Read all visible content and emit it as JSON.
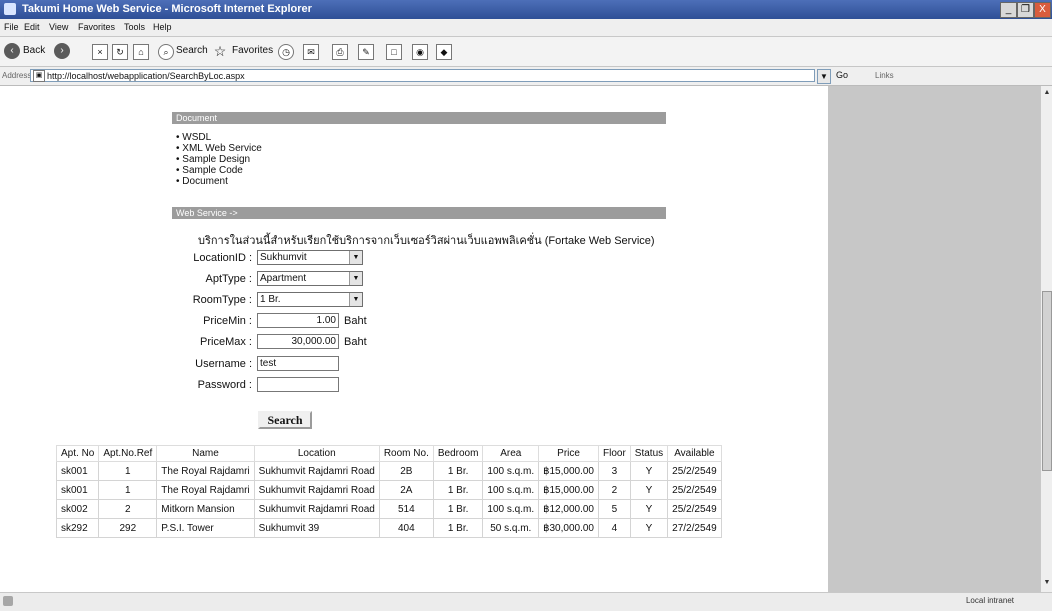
{
  "window": {
    "title": "Takumi Home Web Service - Microsoft Internet Explorer",
    "minimize": "_",
    "restore": "❐",
    "close": "X"
  },
  "menu": [
    "File",
    "Edit",
    "View",
    "Favorites",
    "Tools",
    "Help"
  ],
  "toolbar": {
    "back_label": "Back",
    "search_label": "Search",
    "favorites_label": "Favorites"
  },
  "address": {
    "label": "Address",
    "url": "http://localhost/webapplication/SearchByLoc.aspx",
    "go_label": "Go",
    "links_label": "Links"
  },
  "document_section": {
    "header": "Document",
    "items": [
      "WSDL",
      "XML Web Service",
      "Sample Design",
      "Sample Code",
      "Document"
    ]
  },
  "web_service_section": {
    "header": "Web Service ->",
    "description": "บริการในส่วนนี้สำหรับเรียกใช้บริการจากเว็บเซอร์วิสผ่านเว็บแอพพลิเคชั่น (Fortake Web Service)"
  },
  "form": {
    "location_label": "LocationID :",
    "location_value": "Sukhumvit",
    "apt_type_label": "AptType :",
    "apt_type_value": "Apartment",
    "room_type_label": "RoomType :",
    "room_type_value": "1 Br.",
    "price_min_label": "PriceMin :",
    "price_min_value": "1.00",
    "price_min_unit": "Baht",
    "price_max_label": "PriceMax :",
    "price_max_value": "30,000.00",
    "price_max_unit": "Baht",
    "username_label": "Username :",
    "username_value": "test",
    "password_label": "Password :",
    "password_value": "",
    "search_button": "Search"
  },
  "results": {
    "headers": [
      "Apt. No",
      "Apt.No.Ref",
      "Name",
      "Location",
      "Room No.",
      "Bedroom",
      "Area",
      "Price",
      "Floor",
      "Status",
      "Available"
    ],
    "rows": [
      [
        "sk001",
        "1",
        "The Royal Rajdamri",
        "Sukhumvit Rajdamri Road",
        "2B",
        "1 Br.",
        "100 s.q.m.",
        "฿15,000.00",
        "3",
        "Y",
        "25/2/2549"
      ],
      [
        "sk001",
        "1",
        "The Royal Rajdamri",
        "Sukhumvit Rajdamri Road",
        "2A",
        "1 Br.",
        "100 s.q.m.",
        "฿15,000.00",
        "2",
        "Y",
        "25/2/2549"
      ],
      [
        "sk002",
        "2",
        "Mitkorn Mansion",
        "Sukhumvit Rajdamri Road",
        "514",
        "1 Br.",
        "100 s.q.m.",
        "฿12,000.00",
        "5",
        "Y",
        "25/2/2549"
      ],
      [
        "sk292",
        "292",
        "P.S.I. Tower",
        "Sukhumvit 39",
        "404",
        "1 Br.",
        "50 s.q.m.",
        "฿30,000.00",
        "4",
        "Y",
        "27/2/2549"
      ]
    ]
  },
  "status": {
    "zone": "Local intranet"
  }
}
